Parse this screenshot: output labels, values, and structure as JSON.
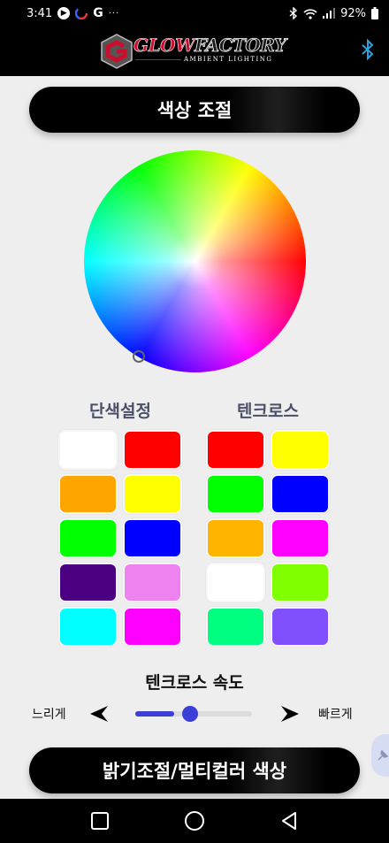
{
  "status_bar": {
    "time": "3:41",
    "battery": "92%",
    "icons": [
      "play-icon",
      "app-icon",
      "google-icon",
      "more-notifications-icon",
      "bluetooth-icon",
      "wifi-icon",
      "signal-icon",
      "battery-icon"
    ],
    "google_letter": "G",
    "dots": "···"
  },
  "header": {
    "logo_glow": "GLOW",
    "logo_factory": "FACTORY",
    "logo_tagline": "AMBIENT LIGHTING",
    "bluetooth_color": "#2aa3e0"
  },
  "color_control": {
    "title": "색상 조절"
  },
  "solid": {
    "title": "단색설정",
    "swatches": [
      "#ffffff",
      "#ff0000",
      "#ffa500",
      "#ffff00",
      "#00ff00",
      "#0000ff",
      "#4b0082",
      "#ee82ee",
      "#00ffff",
      "#ff00ff"
    ]
  },
  "techno": {
    "title": "텐크로스",
    "swatches": [
      "#ff0000",
      "#ffff00",
      "#00ff00",
      "#0000ff",
      "#ffb400",
      "#ff00ff",
      "#ffffff",
      "#80ff00",
      "#00ff80",
      "#8050ff"
    ]
  },
  "speed": {
    "title": "텐크로스 속도",
    "slow_label": "느리게",
    "fast_label": "빠르게",
    "value_fraction": 0.5,
    "accent": "#3b3fd6"
  },
  "brightness": {
    "title": "밝기조절/멀티컬러 색상"
  }
}
